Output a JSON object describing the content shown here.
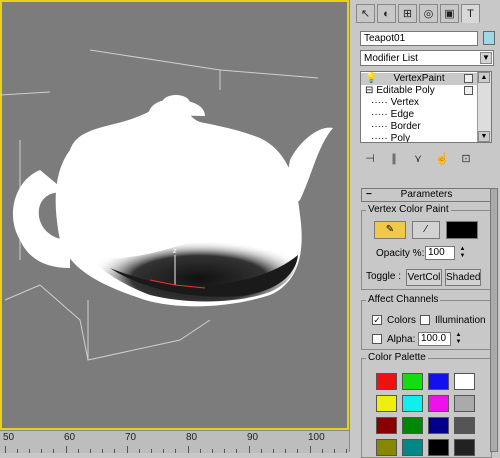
{
  "timeline": {
    "ticks": [
      "50",
      "60",
      "70",
      "80",
      "90",
      "100"
    ]
  },
  "viewport": {
    "axis_label": "z"
  },
  "panel": {
    "tab_icons": [
      "pointer-icon",
      "arc-icon",
      "hierarchy-icon",
      "motion-icon",
      "display-icon",
      "hammer-icon"
    ],
    "tab_glyphs": [
      "↖",
      "◐",
      "⊞",
      "◎",
      "▣",
      "T"
    ],
    "object_name": "Teapot01",
    "object_color": "#9ed7e6",
    "modifier_list": "Modifier List",
    "stack": [
      {
        "label": "VertexPaint",
        "prefix": "💡",
        "selected": true
      },
      {
        "label": "Editable Poly",
        "prefix": "⊟",
        "selected": false
      },
      {
        "label": "Vertex",
        "prefix": "·····",
        "selected": false
      },
      {
        "label": "Edge",
        "prefix": "·····",
        "selected": false
      },
      {
        "label": "Border",
        "prefix": "·····",
        "selected": false
      },
      {
        "label": "Poly",
        "prefix": "·····",
        "selected": false
      }
    ],
    "tools": [
      "⊣",
      "∥",
      "⋎",
      "☝",
      "⊡"
    ],
    "parameters": {
      "title": "Parameters",
      "vertex_color_paint": "Vertex Color Paint",
      "paint_color": "#000000",
      "opacity_label": "Opacity %:",
      "opacity_value": "100",
      "toggle_label": "Toggle :",
      "vertcol_label": "VertCol",
      "shaded_label": "Shaded",
      "affect_channels": "Affect Channels",
      "colors_label": "Colors",
      "colors_checked": "✓",
      "illumination_label": "Illumination",
      "alpha_label": "Alpha:",
      "alpha_value": "100.0",
      "color_palette": "Color Palette",
      "palette": [
        "#ee1111",
        "#11dd11",
        "#1111ee",
        "#ffffff",
        "#eeee11",
        "#11eeee",
        "#ee11ee",
        "#aaaaaa",
        "#880000",
        "#008800",
        "#000088",
        "#555555",
        "#888800",
        "#008888",
        "#000000",
        "#222222"
      ]
    }
  }
}
